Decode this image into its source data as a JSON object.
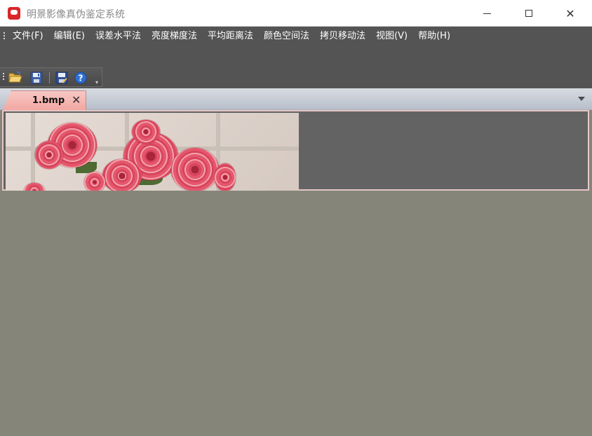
{
  "window": {
    "title": "明景影像真伪鉴定系统",
    "minimize_icon": "minimize-icon",
    "maximize_icon": "maximize-icon",
    "close_glyph": "✕"
  },
  "menu": {
    "items": [
      {
        "label": "文件(F)"
      },
      {
        "label": "编辑(E)"
      },
      {
        "label": "误差水平法"
      },
      {
        "label": "亮度梯度法"
      },
      {
        "label": "平均距离法"
      },
      {
        "label": "颜色空间法"
      },
      {
        "label": "拷贝移动法"
      },
      {
        "label": "视图(V)"
      },
      {
        "label": "帮助(H)"
      }
    ]
  },
  "toolbar": {
    "buttons": [
      {
        "icon": "folder-open-icon"
      },
      {
        "icon": "save-icon"
      },
      {
        "icon": "save-as-icon"
      },
      {
        "icon": "help-icon"
      }
    ],
    "overflow_icon": "toolbar-overflow-icon"
  },
  "tabs": {
    "active": {
      "label": "1.bmp",
      "close_glyph": "✕"
    },
    "dropdown_icon": "tab-dropdown-icon"
  },
  "colors": {
    "menubar_bg": "#545454",
    "tab_active": "#f2a7a2",
    "workspace_bg": "#636363",
    "background": "#86857a",
    "app_icon": "#d9262a"
  }
}
